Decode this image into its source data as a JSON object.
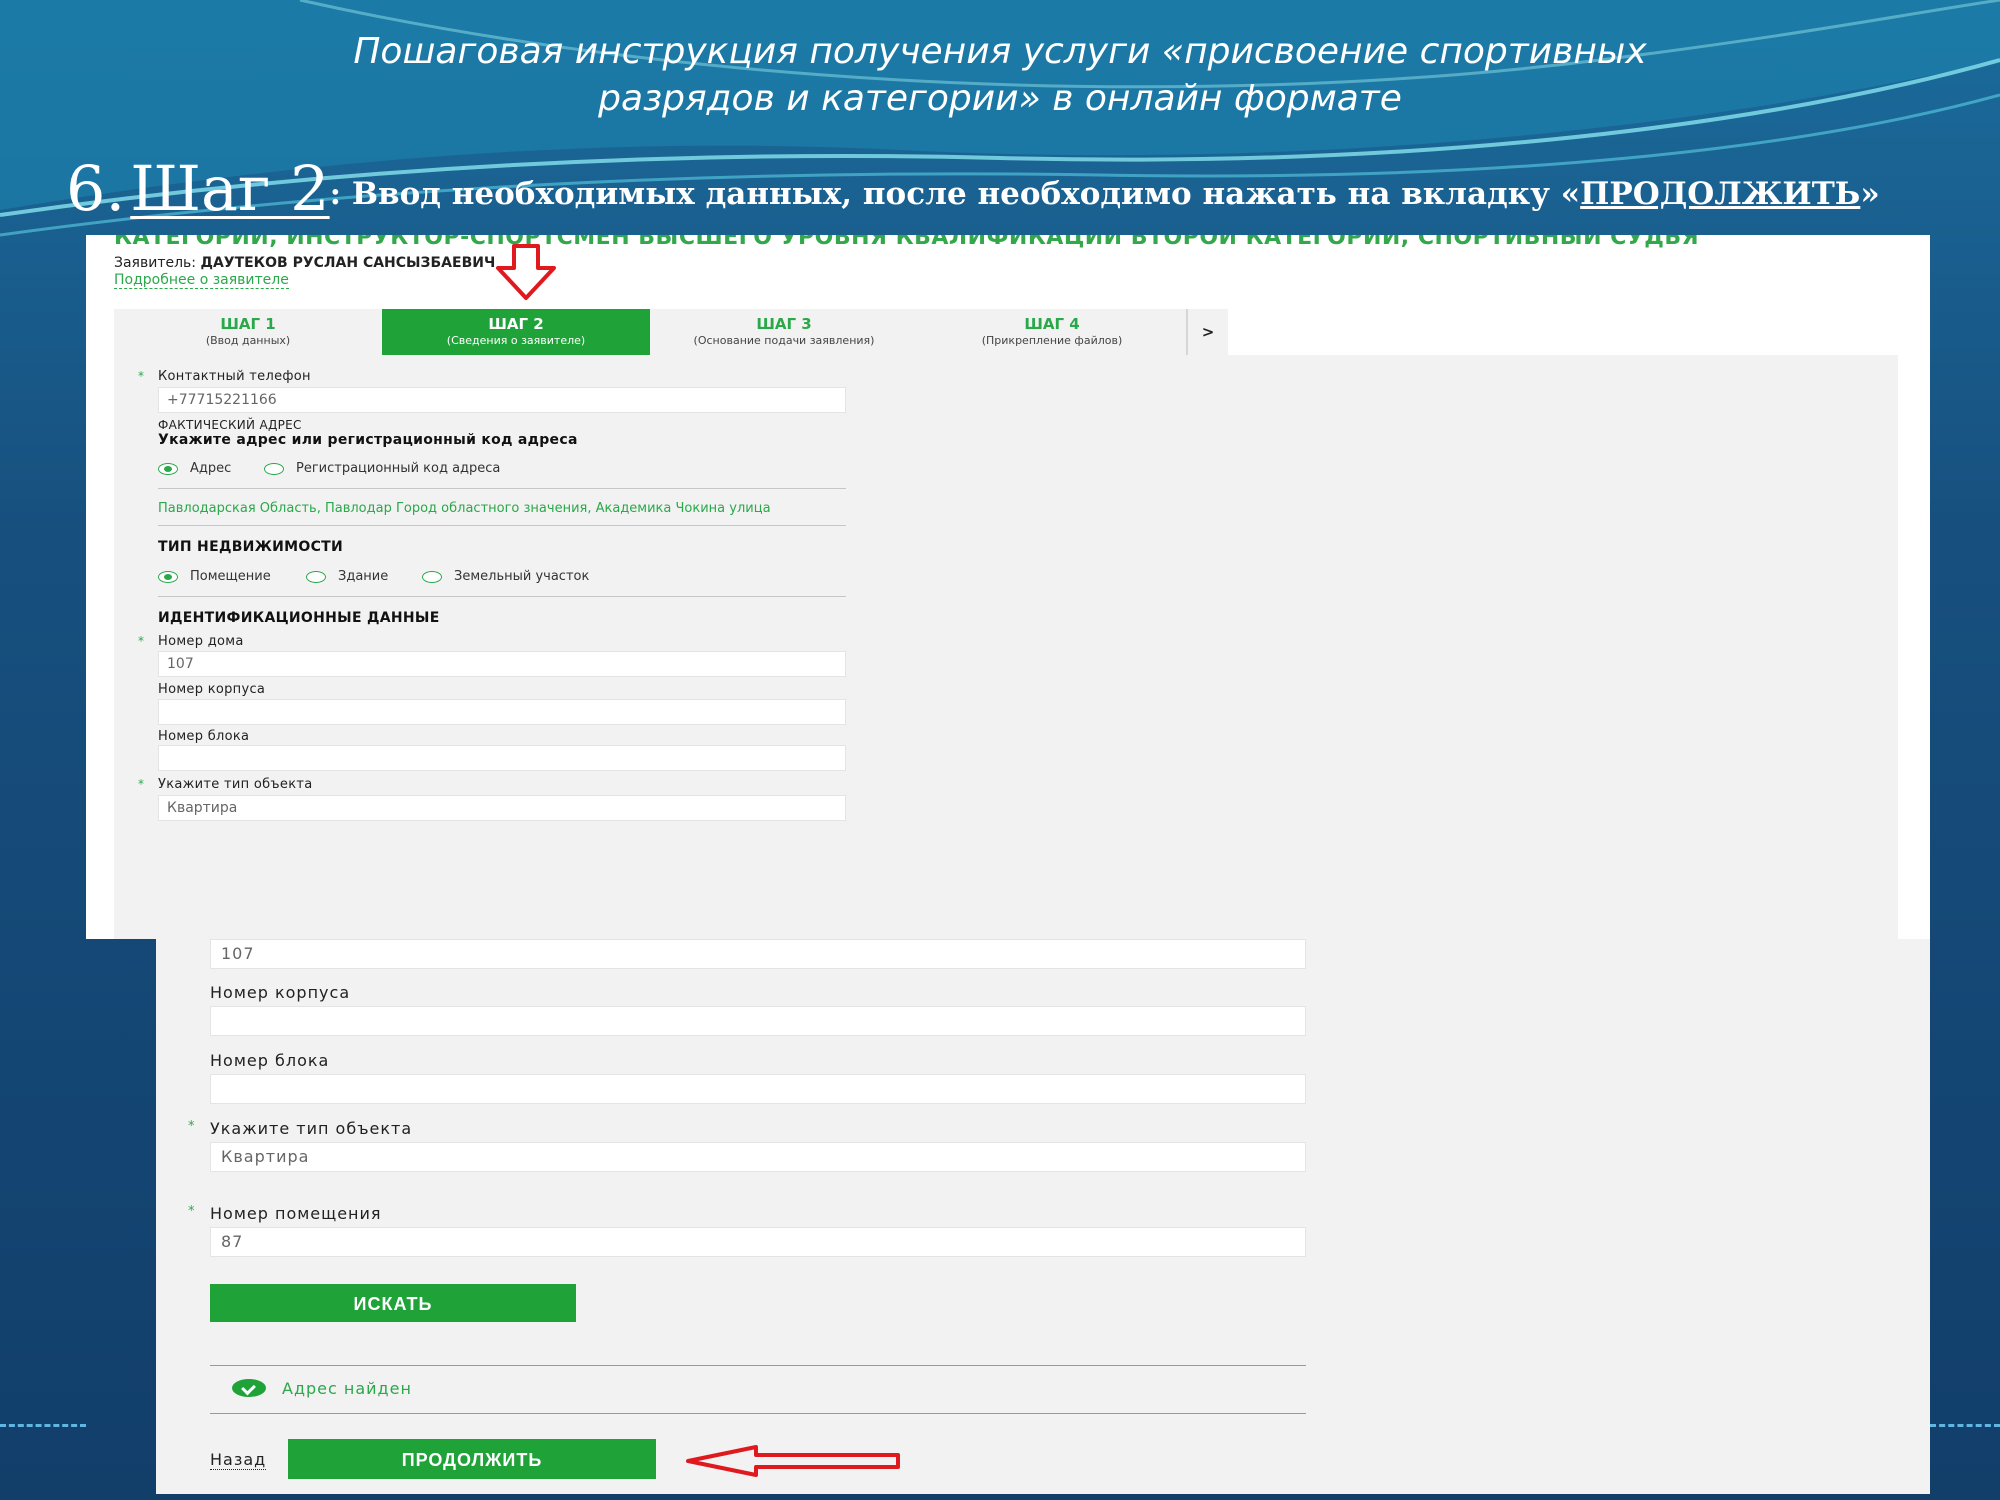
{
  "slide": {
    "title": "Пошаговая инструкция получения услуги «присвоение спортивных разрядов и категории» в онлайн формате",
    "step_number": "6.",
    "step_word": "Шаг 2",
    "step_desc_before": ": Ввод  необходимых данных, после необходимо нажать на вкладку «",
    "step_desc_link": "ПРОДОЛЖИТЬ",
    "step_desc_after": "»"
  },
  "screenshot1": {
    "cut_text": "КАТЕГОРИИ, ИНСТРУКТОР-СПОРТСМЕН ВЫСШЕГО УРОВНЯ КВАЛИФИКАЦИИ ВТОРОЙ КАТЕГОРИИ, СПОРТИВНЫЙ СУДЬЯ",
    "applicant_label": "Заявитель:",
    "applicant_name": "ДАУТЕКОВ РУСЛАН САНСЫЗБАЕВИЧ",
    "more_link": "Подробнее о заявителе",
    "tabs": [
      {
        "label": "ШАГ 1",
        "sub": "(Ввод данных)"
      },
      {
        "label": "ШАГ 2",
        "sub": "(Сведения о заявителе)"
      },
      {
        "label": "ШАГ 3",
        "sub": "(Основание подачи заявления)"
      },
      {
        "label": "ШАГ 4",
        "sub": "(Прикрепление файлов)"
      }
    ],
    "tab_next": ">",
    "phone_label": "Контактный телефон",
    "phone_value": "+77715221166",
    "actual_address": "ФАКТИЧЕСКИЙ АДРЕС",
    "address_prompt": "Укажите адрес или регистрационный код адреса",
    "radio_address": "Адрес",
    "radio_regcode": "Регистрационный код адреса",
    "address_value": "Павлодарская Область, Павлодар Город областного значения, Академика Чокина улица",
    "property_type_title": "ТИП НЕДВИЖИМОСТИ",
    "property_options": [
      "Помещение",
      "Здание",
      "Земельный участок"
    ],
    "id_data_title": "ИДЕНТИФИКАЦИОННЫЕ ДАННЫЕ",
    "house_label": "Номер дома",
    "house_value": "107",
    "building_label": "Номер корпуса",
    "block_label": "Номер блока",
    "object_type_label": "Укажите тип объекта",
    "object_type_value": "Квартира"
  },
  "screenshot2": {
    "house_value": "107",
    "building_label": "Номер корпуса",
    "block_label": "Номер блока",
    "object_type_label": "Укажите тип объекта",
    "object_type_value": "Квартира",
    "room_label": "Номер помещения",
    "room_value": "87",
    "search_button": "ИСКАТЬ",
    "found_text": "Адрес найден",
    "back_link": "Назад",
    "continue_button": "ПРОДОЛЖИТЬ"
  },
  "colors": {
    "accent_green": "#1fa339",
    "highlight_red": "#e0191f",
    "background_blue": "#17507f"
  }
}
